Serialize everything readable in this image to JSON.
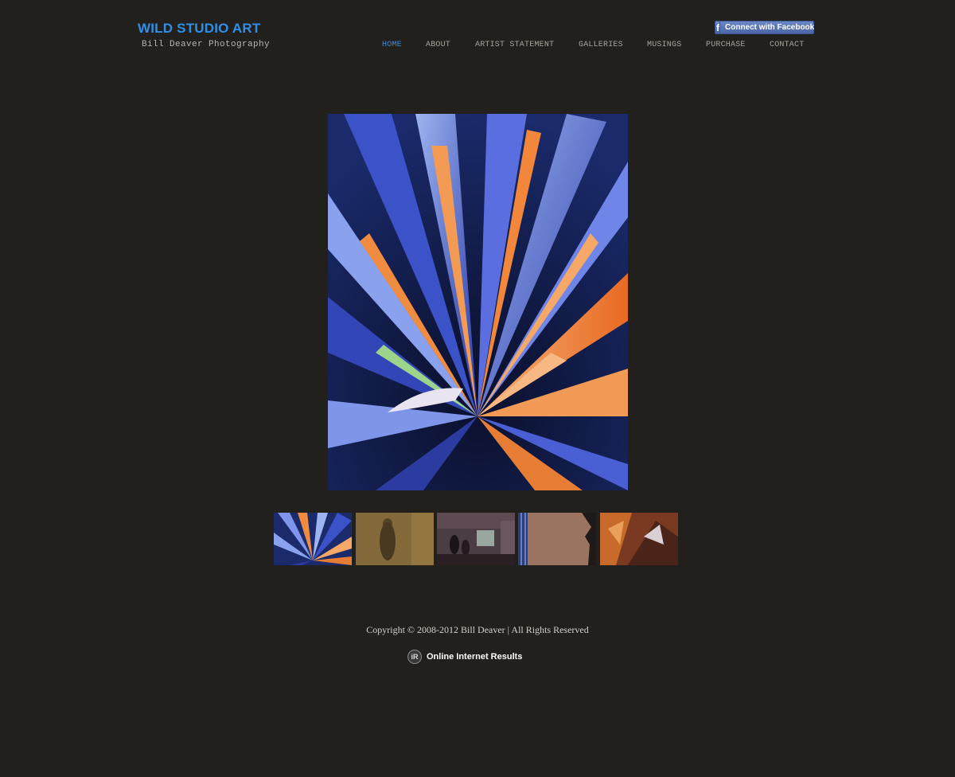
{
  "header": {
    "title": "WILD STUDIO ART",
    "subtitle": "Bill Deaver Photography",
    "facebook_button": {
      "label": "Connect with Facebook",
      "icon": "facebook-icon"
    }
  },
  "nav": {
    "items": [
      {
        "label": "HOME",
        "active": true
      },
      {
        "label": "ABOUT",
        "active": false
      },
      {
        "label": "ARTIST STATEMENT",
        "active": false
      },
      {
        "label": "GALLERIES",
        "active": false
      },
      {
        "label": "MUSINGS",
        "active": false
      },
      {
        "label": "PURCHASE",
        "active": false
      },
      {
        "label": "CONTACT",
        "active": false
      }
    ],
    "active_color": "#2f8fe8"
  },
  "main_photo": {
    "subject": "agave-plant-photo"
  },
  "thumbnails": [
    {
      "subject": "agave-thumbnail"
    },
    {
      "subject": "blurred-figure-thumbnail"
    },
    {
      "subject": "gallery-interior-thumbnail"
    },
    {
      "subject": "building-wall-thumbnail"
    },
    {
      "subject": "abstract-orange-thumbnail"
    }
  ],
  "footer": {
    "copyright": "Copyright © 2008-2012 Bill Deaver | All Rights Reserved",
    "credit_badge": "iR",
    "credit_text": "Online Internet Results"
  },
  "colors": {
    "background": "#22201d",
    "brand": "#2f8fe8",
    "facebook": "#4a66a6"
  }
}
